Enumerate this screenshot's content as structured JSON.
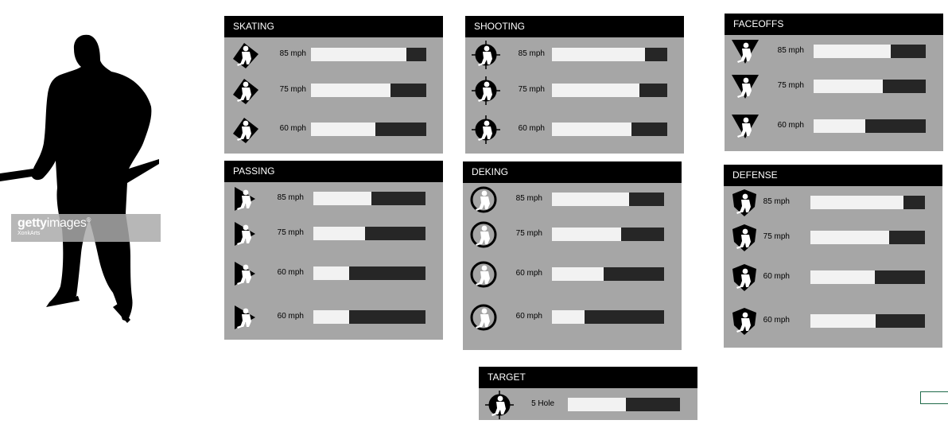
{
  "watermark": {
    "logo_bold": "getty",
    "logo_rest": "images",
    "registered": "®",
    "credit": "XonkArts"
  },
  "panels": [
    {
      "id": "skating",
      "title": "SKATING",
      "rows": [
        {
          "value": "85 mph",
          "fill": 0.83,
          "icon": "skater-forward-icon"
        },
        {
          "value": "75 mph",
          "fill": 0.69,
          "icon": "skater-crossover-icon"
        },
        {
          "value": "60 mph",
          "fill": 0.56,
          "icon": "skater-stride-icon"
        }
      ]
    },
    {
      "id": "shooting",
      "title": "SHOOTING",
      "rows": [
        {
          "value": "85 mph",
          "fill": 0.81,
          "icon": "slapshot-target-icon"
        },
        {
          "value": "75 mph",
          "fill": 0.76,
          "icon": "wristshot-target-icon"
        },
        {
          "value": "60 mph",
          "fill": 0.69,
          "icon": "snapshot-target-icon"
        }
      ]
    },
    {
      "id": "faceoffs",
      "title": "FACEOFFS",
      "rows": [
        {
          "value": "85 mph",
          "fill": 0.69,
          "icon": "faceoff-forward-icon"
        },
        {
          "value": "75 mph",
          "fill": 0.62,
          "icon": "faceoff-backhand-icon"
        },
        {
          "value": "60 mph",
          "fill": 0.46,
          "icon": "faceoff-tie-icon"
        }
      ]
    },
    {
      "id": "passing",
      "title": "PASSING",
      "rows": [
        {
          "value": "85 mph",
          "fill": 0.52,
          "icon": "pass-direct-icon"
        },
        {
          "value": "75 mph",
          "fill": 0.46,
          "icon": "pass-saucer-icon"
        },
        {
          "value": "60 mph",
          "fill": 0.32,
          "icon": "pass-board-icon"
        },
        {
          "value": "60 mph",
          "fill": 0.32,
          "icon": "pass-rim-icon"
        }
      ]
    },
    {
      "id": "deking",
      "title": "DEKING",
      "rows": [
        {
          "value": "85 mph",
          "fill": 0.69,
          "icon": "deke-left-icon"
        },
        {
          "value": "75 mph",
          "fill": 0.62,
          "icon": "deke-right-icon"
        },
        {
          "value": "60 mph",
          "fill": 0.46,
          "icon": "deke-spin-icon"
        },
        {
          "value": "60 mph",
          "fill": 0.29,
          "icon": "deke-backhand-icon"
        }
      ]
    },
    {
      "id": "defense",
      "title": "DEFENSE",
      "rows": [
        {
          "value": "85 mph",
          "fill": 0.81,
          "icon": "defense-poke-icon"
        },
        {
          "value": "75 mph",
          "fill": 0.69,
          "icon": "defense-block-icon"
        },
        {
          "value": "60 mph",
          "fill": 0.56,
          "icon": "defense-check-icon"
        },
        {
          "value": "60 mph",
          "fill": 0.57,
          "icon": "defense-lift-icon"
        }
      ]
    },
    {
      "id": "target",
      "title": "TARGET",
      "rows": [
        {
          "value": "5 Hole",
          "fill": 0.52,
          "icon": "five-hole-target-icon"
        }
      ]
    }
  ],
  "colors": {
    "panel_bg": "#a6a6a6",
    "header_bg": "#000000",
    "bar_empty": "#262626",
    "bar_fill": "#f2f2f2",
    "accent_green": "#1f6b4a"
  }
}
